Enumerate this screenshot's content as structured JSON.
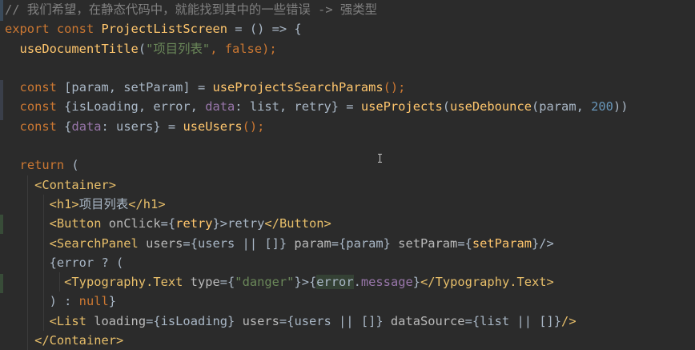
{
  "editor": {
    "lines": [
      [
        {
          "t": "// 我们希望，在静态代码中，就能找到其中的一些错误 -> 强类型",
          "c": "cm"
        }
      ],
      [
        {
          "t": "export ",
          "c": "kw"
        },
        {
          "t": "const ",
          "c": "kw"
        },
        {
          "t": "ProjectListScreen",
          "c": "fn"
        },
        {
          "t": " = () => {",
          "c": "var"
        }
      ],
      [
        {
          "t": "  ",
          "c": "var"
        },
        {
          "t": "useDocumentTitle",
          "c": "fn"
        },
        {
          "t": "(",
          "c": "var"
        },
        {
          "t": "\"项目列表\"",
          "c": "str"
        },
        {
          "t": ", ",
          "c": "pun"
        },
        {
          "t": "false",
          "c": "kw"
        },
        {
          "t": ");",
          "c": "pun"
        }
      ],
      [
        {
          "t": "",
          "c": "var"
        }
      ],
      [
        {
          "t": "  ",
          "c": "var"
        },
        {
          "t": "const ",
          "c": "kw"
        },
        {
          "t": "[param, setParam] = ",
          "c": "var"
        },
        {
          "t": "useProjectsSearchParams",
          "c": "fn"
        },
        {
          "t": "();",
          "c": "pun"
        }
      ],
      [
        {
          "t": "  ",
          "c": "var"
        },
        {
          "t": "const ",
          "c": "kw"
        },
        {
          "t": "{isLoading, error, ",
          "c": "var"
        },
        {
          "t": "data",
          "c": "prop"
        },
        {
          "t": ": list, retry} = ",
          "c": "var"
        },
        {
          "t": "useProjects",
          "c": "fn"
        },
        {
          "t": "(",
          "c": "var"
        },
        {
          "t": "useDebounce",
          "c": "fn"
        },
        {
          "t": "(param, ",
          "c": "var"
        },
        {
          "t": "200",
          "c": "num"
        },
        {
          "t": "))",
          "c": "var"
        }
      ],
      [
        {
          "t": "  ",
          "c": "var"
        },
        {
          "t": "const ",
          "c": "kw"
        },
        {
          "t": "{",
          "c": "var"
        },
        {
          "t": "data",
          "c": "prop"
        },
        {
          "t": ": users} = ",
          "c": "var"
        },
        {
          "t": "useUsers",
          "c": "fn"
        },
        {
          "t": "();",
          "c": "pun"
        }
      ],
      [
        {
          "t": "",
          "c": "var"
        }
      ],
      [
        {
          "t": "  ",
          "c": "var"
        },
        {
          "t": "return ",
          "c": "kw"
        },
        {
          "t": "(",
          "c": "var"
        }
      ],
      [
        {
          "t": "    ",
          "c": "var"
        },
        {
          "t": "<Container>",
          "c": "tag"
        }
      ],
      [
        {
          "t": "      ",
          "c": "var"
        },
        {
          "t": "<h1>",
          "c": "tag"
        },
        {
          "t": "项目列表",
          "c": "var"
        },
        {
          "t": "</h1>",
          "c": "tag"
        }
      ],
      [
        {
          "t": "      ",
          "c": "var"
        },
        {
          "t": "<Button ",
          "c": "tag"
        },
        {
          "t": "onClick",
          "c": "attr"
        },
        {
          "t": "={",
          "c": "var"
        },
        {
          "t": "retry",
          "c": "fn"
        },
        {
          "t": "}>",
          "c": "var"
        },
        {
          "t": "retry",
          "c": "var"
        },
        {
          "t": "</Button>",
          "c": "tag"
        }
      ],
      [
        {
          "t": "      ",
          "c": "var"
        },
        {
          "t": "<SearchPanel ",
          "c": "tag"
        },
        {
          "t": "users",
          "c": "attr"
        },
        {
          "t": "={users || []} ",
          "c": "var"
        },
        {
          "t": "param",
          "c": "attr"
        },
        {
          "t": "={param} ",
          "c": "var"
        },
        {
          "t": "setParam",
          "c": "attr"
        },
        {
          "t": "={",
          "c": "var"
        },
        {
          "t": "setParam",
          "c": "fn"
        },
        {
          "t": "}/>",
          "c": "var"
        }
      ],
      [
        {
          "t": "      {error ? (",
          "c": "var"
        }
      ],
      [
        {
          "t": "        ",
          "c": "var"
        },
        {
          "t": "<Typography.Text ",
          "c": "tag"
        },
        {
          "t": "type",
          "c": "attr"
        },
        {
          "t": "={",
          "c": "var"
        },
        {
          "t": "\"danger\"",
          "c": "str"
        },
        {
          "t": "}>{",
          "c": "var"
        },
        {
          "t": "error",
          "c": "err"
        },
        {
          "t": ".",
          "c": "var"
        },
        {
          "t": "message",
          "c": "prop"
        },
        {
          "t": "}",
          "c": "var"
        },
        {
          "t": "</Typography.Text>",
          "c": "tag"
        }
      ],
      [
        {
          "t": "      ) : ",
          "c": "var"
        },
        {
          "t": "null",
          "c": "kw"
        },
        {
          "t": "}",
          "c": "var"
        }
      ],
      [
        {
          "t": "      ",
          "c": "var"
        },
        {
          "t": "<List ",
          "c": "tag"
        },
        {
          "t": "loading",
          "c": "attr"
        },
        {
          "t": "={isLoading} ",
          "c": "var"
        },
        {
          "t": "users",
          "c": "attr"
        },
        {
          "t": "={users || []} ",
          "c": "var"
        },
        {
          "t": "dataSource",
          "c": "attr"
        },
        {
          "t": "={list || []}",
          "c": "var"
        },
        {
          "t": "/>",
          "c": "tag"
        }
      ],
      [
        {
          "t": "    ",
          "c": "var"
        },
        {
          "t": "</Container>",
          "c": "tag"
        }
      ]
    ]
  },
  "colors": {
    "background": "#2b2b2b",
    "gutter_change": "#384c38",
    "gutter_modified": "#43454a",
    "caret": "#c8c8c8"
  }
}
